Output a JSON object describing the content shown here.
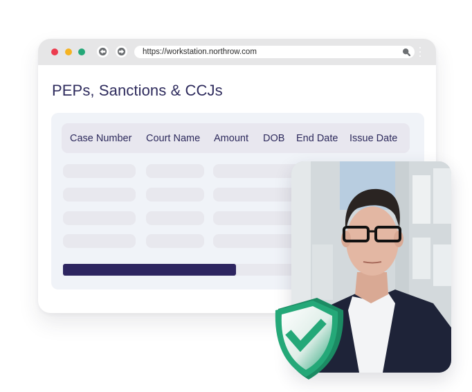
{
  "browser": {
    "url": "https://workstation.northrow.com",
    "window_controls": [
      "close",
      "minimize",
      "maximize"
    ],
    "nav_icons": [
      "back-arrow-icon",
      "forward-arrow-icon"
    ],
    "search_icon": "search-icon",
    "menu_icon": "kebab-menu-icon"
  },
  "page": {
    "title": "PEPs, Sanctions & CCJs"
  },
  "table": {
    "columns": [
      "Case Number",
      "Court Name",
      "Amount",
      "DOB",
      "End Date",
      "Issue Date"
    ],
    "rows_loading": 4,
    "progress_percent": 50
  },
  "photo": {
    "description": "Portrait of a man with glasses wearing a dark blazer and white shirt"
  },
  "badge": {
    "icon": "shield-check-icon",
    "status": "verified"
  },
  "colors": {
    "title_text": "#2d2a5c",
    "progress_fill": "#2d2560",
    "shield_green": "#24a878",
    "panel_bg": "#f0f3f8"
  }
}
